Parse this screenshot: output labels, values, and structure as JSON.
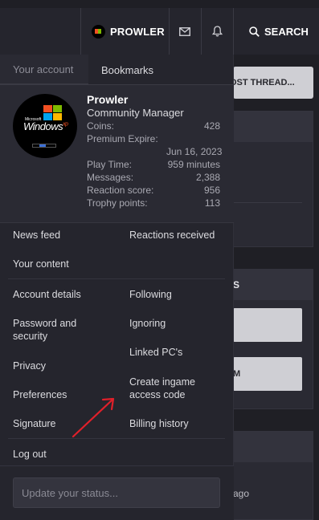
{
  "nav": {
    "username": "PROWLER",
    "search_label": "SEARCH",
    "icons": [
      "avatar",
      "mail-icon",
      "bell-icon",
      "search-icon"
    ]
  },
  "background": {
    "post_thread": "OST THREAD...",
    "block_letter_s": "S",
    "block_letter_m": "M",
    "ago": "ago"
  },
  "menu": {
    "tabs": [
      "Your account",
      "Bookmarks"
    ],
    "profile": {
      "name": "Prowler",
      "role": "Community Manager",
      "coins_label": "Coins:",
      "coins": "428",
      "premium_label": "Premium Expire:",
      "premium_value": "Jun 16, 2023",
      "play_label": "Play Time:",
      "play_value": "959 minutes",
      "messages_label": "Messages:",
      "messages_value": "2,388",
      "reaction_label": "Reaction score:",
      "reaction_value": "956",
      "trophy_label": "Trophy points:",
      "trophy_value": "113",
      "avatar_text": "Windows",
      "avatar_sup": "xp",
      "avatar_ms": "Microsoft"
    },
    "links": {
      "news_feed": "News feed",
      "reactions_received": "Reactions received",
      "your_content": "Your content",
      "account_details": "Account details",
      "following": "Following",
      "password_security": "Password and security",
      "ignoring": "Ignoring",
      "linked_pcs": "Linked PC's",
      "privacy": "Privacy",
      "create_ingame": "Create ingame access code",
      "preferences": "Preferences",
      "signature": "Signature",
      "billing_history": "Billing history",
      "log_out": "Log out"
    },
    "status_placeholder": "Update your status...",
    "annotation_color": "#e0202a"
  }
}
